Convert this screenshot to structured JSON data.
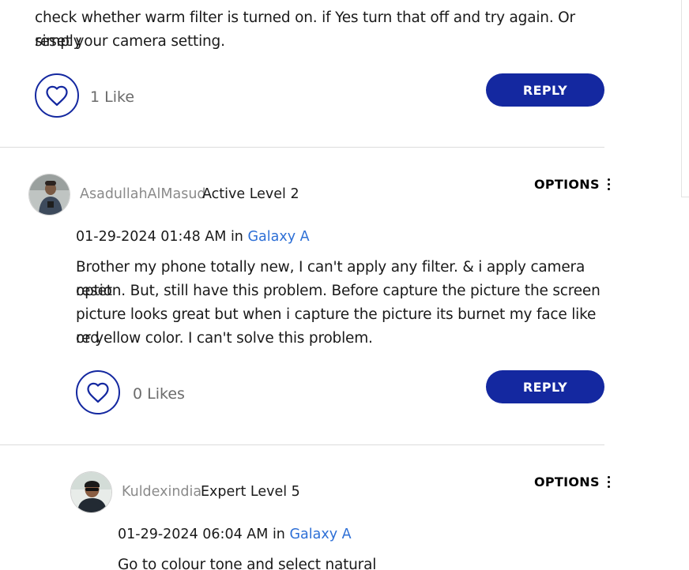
{
  "post1": {
    "text_line1": "check whether warm filter is turned on. if Yes turn that off and try again. Or simply",
    "text_line2": "reset your camera setting.",
    "likes": "1 Like",
    "reply_label": "REPLY"
  },
  "post2": {
    "username": "AsadullahAlMasud",
    "rank": "Active Level 2",
    "options_label": "OPTIONS",
    "date": "01-29-2024",
    "time": "01:48 AM",
    "in_word": "in",
    "board": "Galaxy A",
    "text_line1": "Brother my phone totally new, I can't apply any filter. & i apply camera reset",
    "text_line2": "option. But, still have this problem. Before capture the picture the screen",
    "text_line3": "picture looks great but when i capture the picture its burnet my face like red",
    "text_line4": "or yellow color. I can't solve this problem.",
    "likes": "0 Likes",
    "reply_label": "REPLY"
  },
  "post3": {
    "username": "Kuldexindia",
    "rank": "Expert Level 5",
    "options_label": "OPTIONS",
    "date": "01-29-2024",
    "time": "06:04 AM",
    "in_word": "in",
    "board": "Galaxy A",
    "text_line1": "Go to colour tone and select natural"
  },
  "icons": {
    "like": "heart-outline-icon",
    "options": "kebab-vertical-icon"
  },
  "colors": {
    "accent": "#1428a0",
    "link": "#2d6fd6",
    "username": "#8a8a8a",
    "muted": "#6b6b6b"
  }
}
